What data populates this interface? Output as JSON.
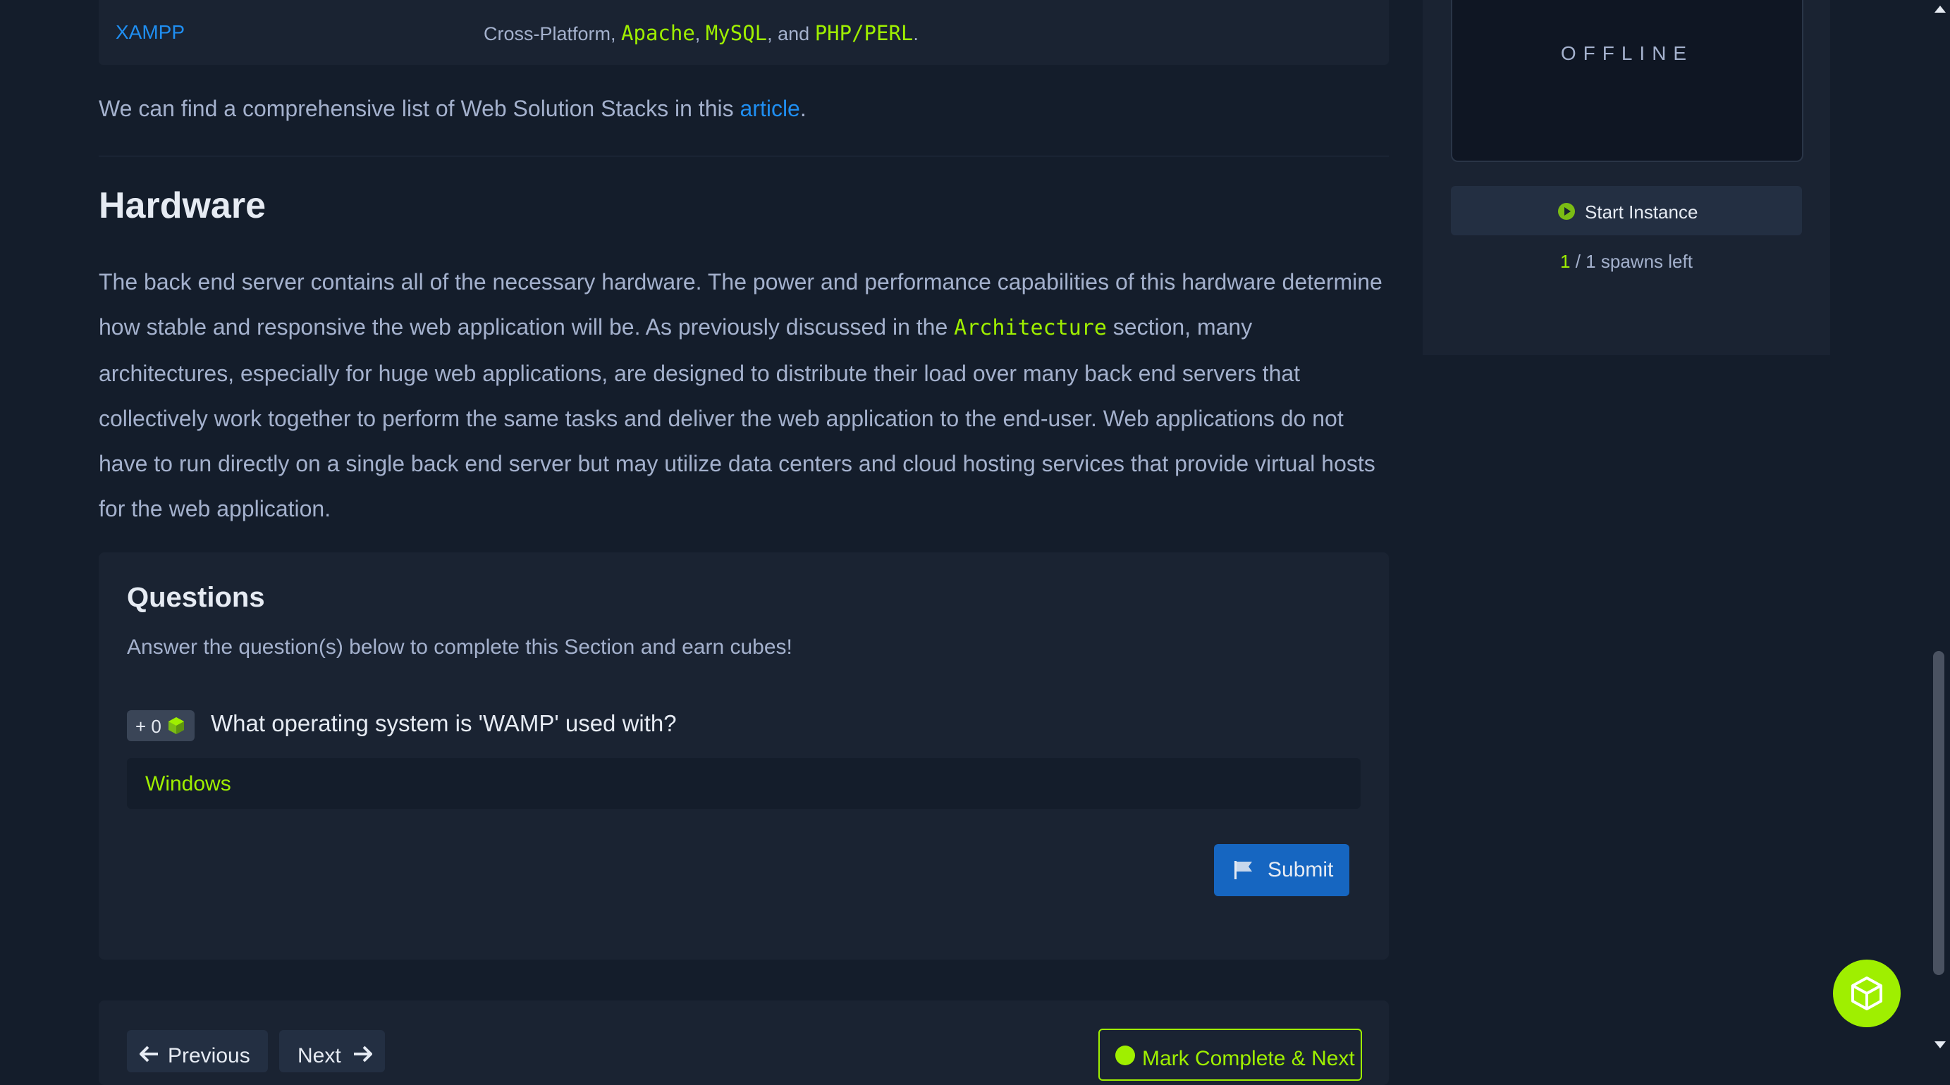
{
  "stack_table": {
    "name": "XAMPP",
    "desc_prefix": "Cross-Platform, ",
    "tech1": "Apache",
    "sep1": ", ",
    "tech2": "MySQL",
    "sep2": ", and ",
    "tech3": "PHP/PERL",
    "suffix": "."
  },
  "article_line": {
    "text": "We can find a comprehensive list of Web Solution Stacks in this ",
    "link": "article",
    "suffix": "."
  },
  "hardware": {
    "heading": "Hardware",
    "para_part1": "The back end server contains all of the necessary hardware. The power and performance capabilities of this hardware determine how stable and responsive the web application will be. As previously discussed in the ",
    "para_code": "Architecture",
    "para_part2": " section, many architectures, especially for huge web applications, are designed to distribute their load over many back end servers that collectively work together to perform the same tasks and deliver the web application to the end-user. Web applications do not have to run directly on a single back end server but may utilize data centers and cloud hosting services that provide virtual hosts for the web application."
  },
  "questions": {
    "title": "Questions",
    "subtitle": "Answer the question(s) below to complete this Section and earn cubes!",
    "items": [
      {
        "badge": "+ 0",
        "text": "What operating system is 'WAMP' used with?",
        "answer": "Windows",
        "submit_label": "Submit"
      }
    ]
  },
  "nav": {
    "previous": "Previous",
    "next": "Next",
    "complete": "Mark Complete & Next"
  },
  "instance": {
    "status": "OFFLINE",
    "start_label": "Start Instance",
    "spawns_count": "1",
    "spawns_rest": " / 1 spawns left"
  },
  "colors": {
    "background": "#141d2b",
    "card": "#1a2332",
    "accent_green": "#9fef00",
    "link_blue": "#1f8ef1",
    "button_blue": "#1666c1"
  }
}
